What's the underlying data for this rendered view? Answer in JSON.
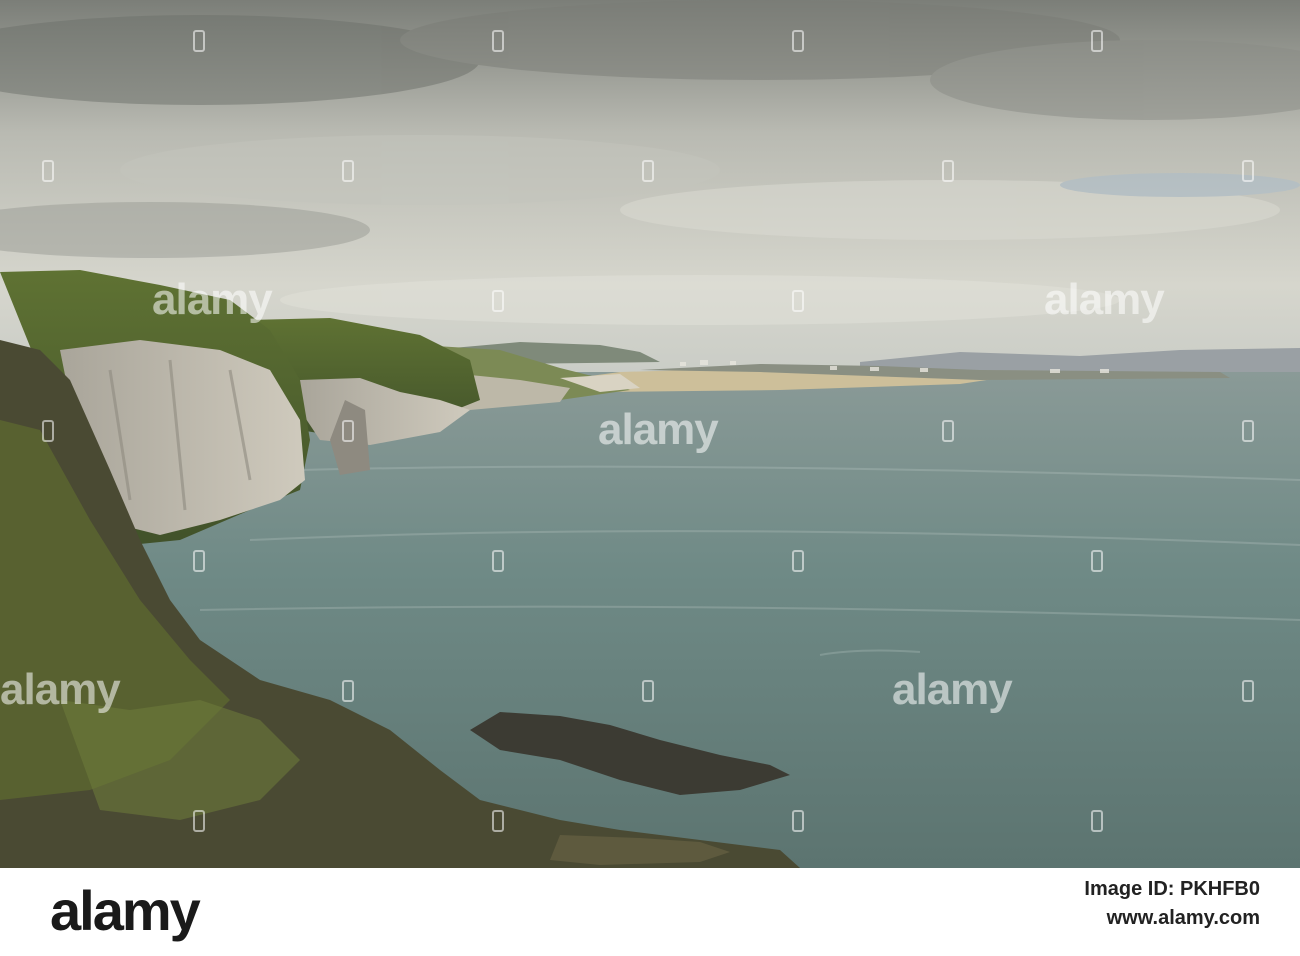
{
  "photo": {
    "subject": "Coastal cliffs and sea with distant town under overcast sky",
    "watermark_text": "alamy"
  },
  "footer": {
    "logo": "alamy",
    "image_id": "Image ID: PKHFB0",
    "site": "www.alamy.com"
  }
}
